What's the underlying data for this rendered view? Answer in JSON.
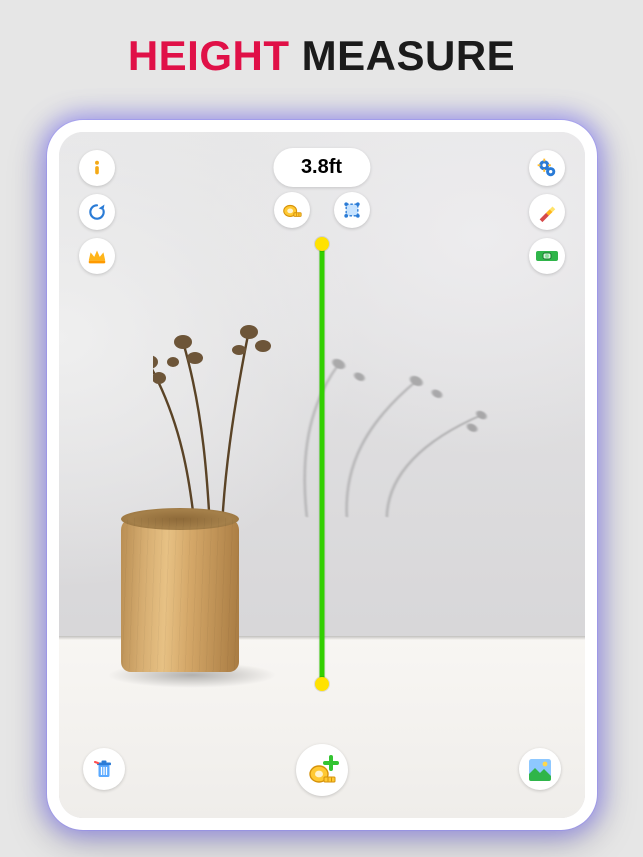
{
  "title": {
    "height": "HEIGHT",
    "measure": "MEASURE"
  },
  "measurement": {
    "display": "3.8ft"
  },
  "icons": {
    "info": "info-icon",
    "reload": "reload-icon",
    "crown": "crown-icon",
    "tape": "tape-icon",
    "area": "area-icon",
    "settings": "settings-icon",
    "flashlight": "flashlight-icon",
    "bubble_level": "level-icon",
    "trash": "trash-icon",
    "add_tape": "add-tape-icon",
    "gallery": "gallery-icon"
  }
}
